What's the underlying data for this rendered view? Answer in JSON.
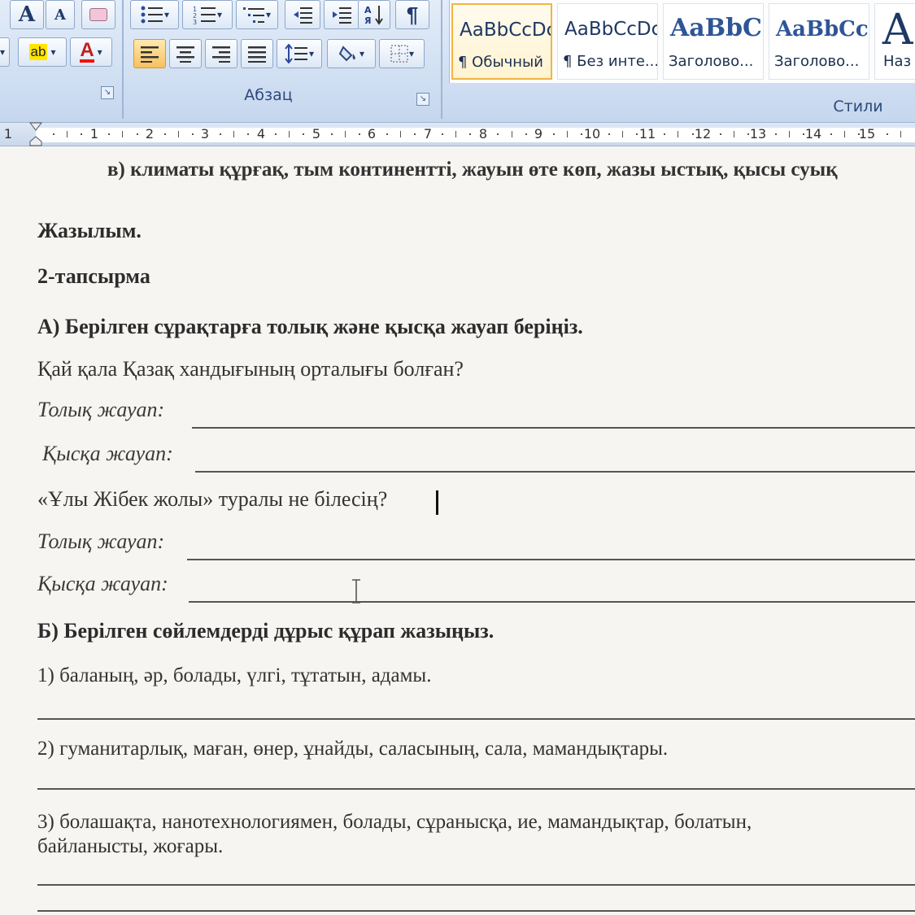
{
  "ribbon": {
    "paragraph_group_label": "Абзац",
    "styles_group_label": "Стили",
    "font_buttons": {
      "grow_font": "A",
      "shrink_font": "A",
      "font_color": "A",
      "highlight": "ab"
    },
    "styles": [
      {
        "sample": "AaBbCcDc",
        "name": "¶ Обычный"
      },
      {
        "sample": "AaBbCcDc",
        "name": "¶ Без инте..."
      },
      {
        "sample": "AaBbC",
        "name": "Заголово..."
      },
      {
        "sample": "AaBbCc",
        "name": "Заголово..."
      },
      {
        "sample": "А",
        "name": "Наз"
      }
    ]
  },
  "ruler": {
    "numbers": [
      "1",
      "1",
      "2",
      "3",
      "4",
      "5",
      "6",
      "7",
      "8",
      "9",
      "10",
      "11",
      "12",
      "13",
      "14",
      "15"
    ]
  },
  "document": {
    "line_top": "в) климаты құрғақ, тым континентті, жауын өте көп, жазы ыстық, қысы суық",
    "section_title": "Жазылым.",
    "task_title": "2-тапсырма",
    "part_a_title": "А) Берілген сұрақтарға толық және қысқа жауап беріңіз.",
    "question_1": "Қай қала Қазақ хандығының орталығы болған?",
    "full_answer_label": "Толық жауап:",
    "short_answer_label": "Қысқа жауап:",
    "question_2": "«Ұлы Жібек жолы» туралы не білесің?",
    "part_b_title": "Б) Берілген сөйлемдерді дұрыс құрап жазыңыз.",
    "sentence_1": "1) баланың, әр, болады, үлгі, тұтатын, адамы.",
    "sentence_2": "2) гуманитарлық, маған, өнер, ұнайды, саласының, сала, мамандықтары.",
    "sentence_3_line1": "3) болашақта, нанотехнологиямен, болады, сұранысқа, ие, мамандықтар, болатын,",
    "sentence_3_line2": "байланысты, жоғары."
  }
}
